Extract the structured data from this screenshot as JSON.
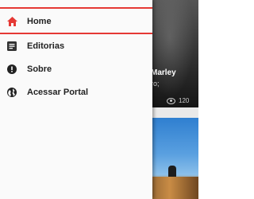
{
  "drawer": {
    "accent_color": "#e53935",
    "items": [
      {
        "label": "Home",
        "icon": "home-icon",
        "active": true
      },
      {
        "label": "Editorias",
        "icon": "article-icon",
        "active": false
      },
      {
        "label": "Sobre",
        "icon": "info-icon",
        "active": false
      },
      {
        "label": "Acessar Portal",
        "icon": "globe-icon",
        "active": false
      }
    ]
  },
  "background_feed": {
    "card1": {
      "title": "Marley",
      "subtitle": "ro;",
      "views": "120"
    }
  }
}
